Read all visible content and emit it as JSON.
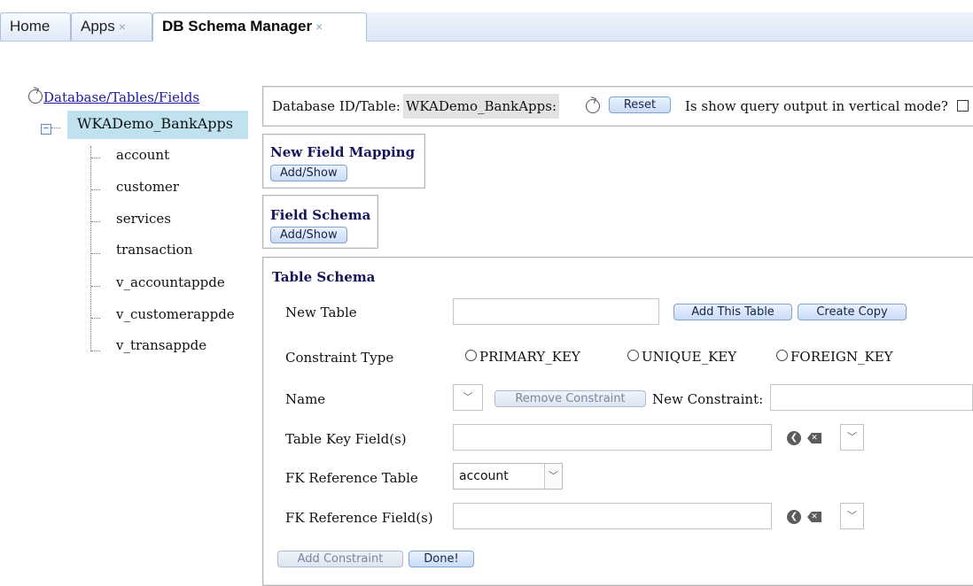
{
  "tabs": [
    {
      "label": "Home",
      "closable": false,
      "active": false
    },
    {
      "label": "Apps",
      "closable": true,
      "active": false
    },
    {
      "label": "DB Schema Manager",
      "closable": true,
      "active": true
    }
  ],
  "tab_close_glyph": "×",
  "tree": {
    "root_label": "Database/Tables/Fields",
    "database": "WKADemo_BankApps",
    "tables": [
      "account",
      "customer",
      "services",
      "transaction",
      "v_accountappde",
      "v_customerappde",
      "v_transappde"
    ]
  },
  "header_panel": {
    "db_label": "Database ID/Table:",
    "db_value": "WKADemo_BankApps:",
    "reset_label": "Reset",
    "vertical_label": "Is show query output in vertical mode?"
  },
  "new_field_mapping": {
    "title": "New Field Mapping",
    "button": "Add/Show"
  },
  "field_schema": {
    "title": "Field Schema",
    "button": "Add/Show"
  },
  "table_schema": {
    "title": "Table Schema",
    "new_table_label": "New Table",
    "add_table_button": "Add This Table",
    "create_copy_button": "Create Copy",
    "constraint_type_label": "Constraint Type",
    "constraint_options": [
      "PRIMARY_KEY",
      "UNIQUE_KEY",
      "FOREIGN_KEY"
    ],
    "name_label": "Name",
    "remove_constraint_button": "Remove Constraint",
    "new_constraint_label": "New Constraint:",
    "table_key_label": "Table Key Field(s)",
    "fk_table_label": "FK Reference Table",
    "fk_table_value": "account",
    "fk_field_label": "FK Reference Field(s)",
    "add_constraint_button": "Add Constraint",
    "done_button": "Done!"
  },
  "icons": {
    "refresh": "refresh-icon",
    "back": "arrow-left-circle-icon",
    "delete": "backspace-icon",
    "dropdown": "chevron-down-icon"
  }
}
